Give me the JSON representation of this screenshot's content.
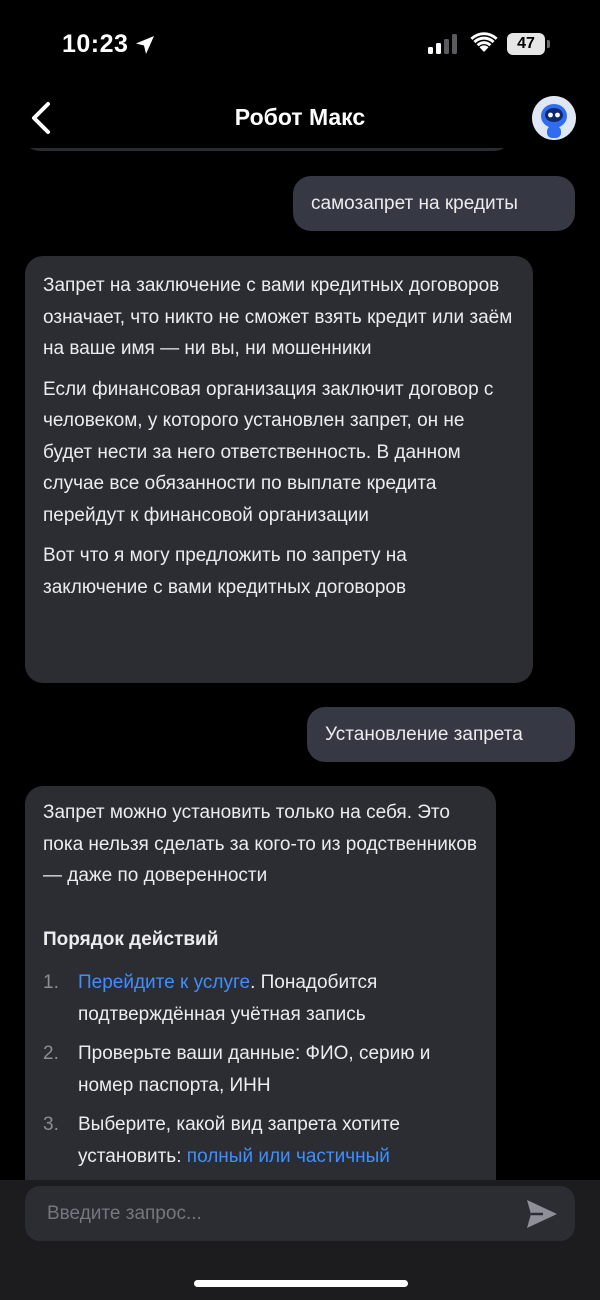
{
  "status": {
    "time": "10:23",
    "battery": "47"
  },
  "nav": {
    "title": "Робот Макс"
  },
  "messages": {
    "m1": "самозапрет на кредиты",
    "m2": {
      "p1": "Запрет на заключение с вами кредитных договоров означает, что никто не сможет взять кредит или заём на ваше имя — ни вы, ни мошенники",
      "p2": "Если финансовая организация заключит договор с человеком, у которого установлен запрет, он не будет нести за него ответственность. В данном случае все обязанности по выплате кредита перейдут к финансовой организации",
      "p3": "Вот что я могу предложить по запрету на заключение с вами кредитных договоров"
    },
    "m3": "Установление запрета",
    "m4": {
      "p1": "Запрет можно установить только на себя. Это пока нельзя сделать за кого-то из родственников — даже по доверенности",
      "heading": "Порядок действий",
      "steps": [
        {
          "num": "1.",
          "link": "Перейдите к услуге",
          "text": ". Понадобится подтверждённая учётная запись"
        },
        {
          "num": "2.",
          "text": "Проверьте ваши данные: ФИО, серию и номер паспорта, ИНН"
        },
        {
          "num": "3.",
          "text": "Выберите, какой вид запрета хотите установить: ",
          "link": "полный или частичный"
        }
      ]
    }
  },
  "input": {
    "placeholder": "Введите запрос..."
  },
  "icons": {
    "location": "location-arrow-icon",
    "signal": "cellular-signal-icon",
    "wifi": "wifi-icon",
    "back": "chevron-left-icon",
    "avatar": "robot-avatar-icon",
    "send": "send-icon"
  },
  "colors": {
    "background": "#000000",
    "bot_bubble": "#2c2d33",
    "user_bubble": "#363843",
    "link": "#3d8fff"
  }
}
